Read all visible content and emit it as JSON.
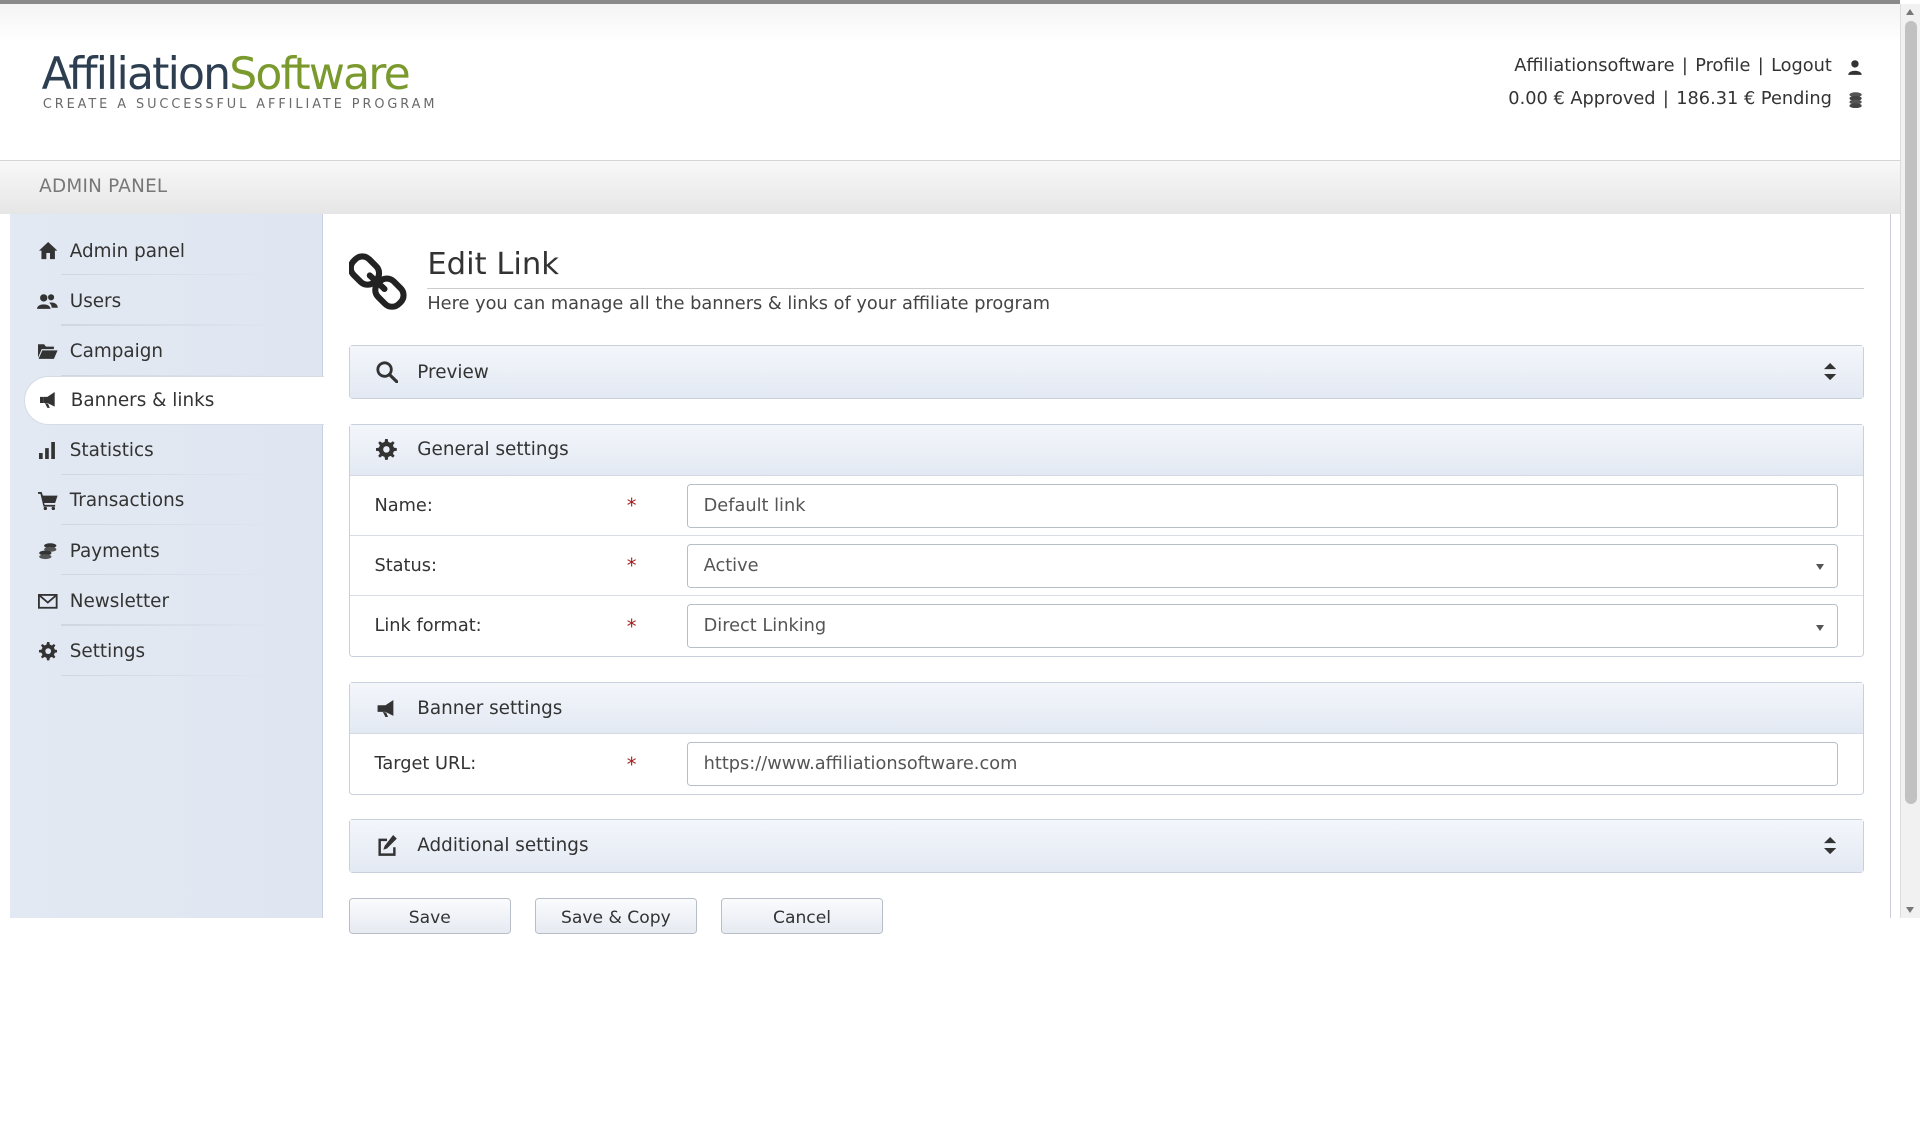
{
  "header": {
    "logo_part1": "Affiliation",
    "logo_part2": "Software",
    "logo_tagline": "CREATE A SUCCESSFUL AFFILIATE PROGRAM",
    "user_name": "Affiliationsoftware",
    "profile_label": "Profile",
    "logout_label": "Logout",
    "separator": "|",
    "approved": "0.00 € Approved",
    "pending": "186.31 € Pending"
  },
  "admin_bar": {
    "title": "ADMIN PANEL"
  },
  "sidebar": {
    "items": [
      {
        "label": "Admin panel",
        "icon": "home-icon"
      },
      {
        "label": "Users",
        "icon": "users-icon"
      },
      {
        "label": "Campaign",
        "icon": "folder-icon"
      },
      {
        "label": "Banners & links",
        "icon": "megaphone-icon",
        "active": true
      },
      {
        "label": "Statistics",
        "icon": "bar-chart-icon"
      },
      {
        "label": "Transactions",
        "icon": "cart-icon"
      },
      {
        "label": "Payments",
        "icon": "coins-icon"
      },
      {
        "label": "Newsletter",
        "icon": "envelope-icon"
      },
      {
        "label": "Settings",
        "icon": "gear-icon"
      }
    ]
  },
  "page": {
    "title": "Edit Link",
    "subtitle": "Here you can manage all the banners & links of your affiliate program",
    "icon": "link-icon"
  },
  "panels": {
    "preview": {
      "title": "Preview",
      "icon": "search-icon"
    },
    "general": {
      "title": "General settings",
      "icon": "gear-icon",
      "required_mark": "*",
      "fields": {
        "name": {
          "label": "Name:",
          "value": "Default link"
        },
        "status": {
          "label": "Status:",
          "value": "Active"
        },
        "link_format": {
          "label": "Link format:",
          "value": "Direct Linking"
        }
      }
    },
    "banner": {
      "title": "Banner settings",
      "icon": "megaphone-icon",
      "fields": {
        "target_url": {
          "label": "Target URL:",
          "value": "https://www.affiliationsoftware.com"
        }
      }
    },
    "additional": {
      "title": "Additional settings",
      "icon": "edit-icon"
    }
  },
  "buttons": {
    "save": "Save",
    "save_copy": "Save & Copy",
    "cancel": "Cancel"
  }
}
